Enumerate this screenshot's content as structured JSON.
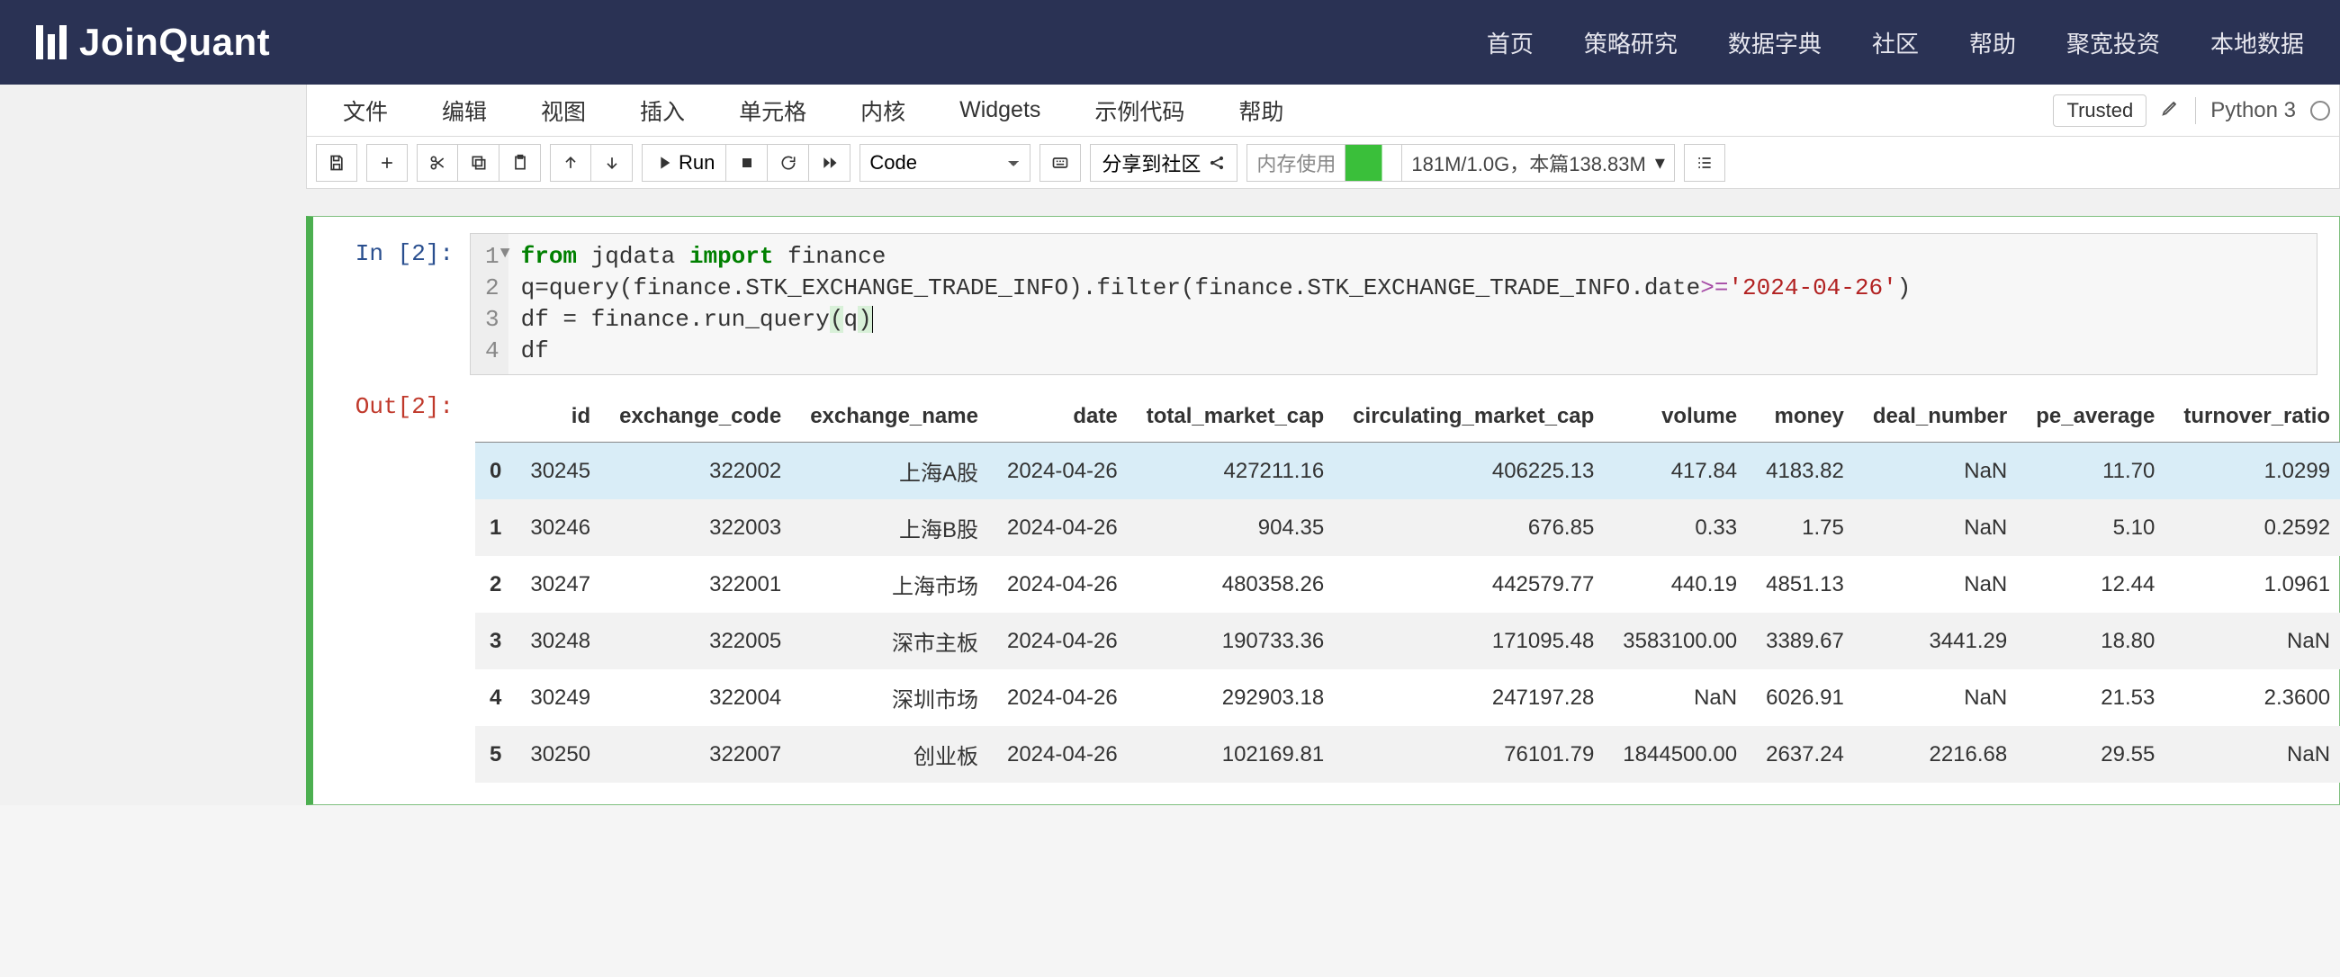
{
  "brand": "JoinQuant",
  "nav": {
    "items": [
      "首页",
      "策略研究",
      "数据字典",
      "社区",
      "帮助",
      "聚宽投资",
      "本地数据"
    ]
  },
  "menubar": {
    "items": [
      "文件",
      "编辑",
      "视图",
      "插入",
      "单元格",
      "内核",
      "Widgets",
      "示例代码",
      "帮助"
    ],
    "trusted": "Trusted",
    "kernel": "Python 3"
  },
  "toolbar": {
    "run": "Run",
    "celltype": "Code",
    "share": "分享到社区",
    "mem_label": "内存使用",
    "mem_text": "181M/1.0G，本篇138.83M"
  },
  "cell": {
    "in_prompt": "In [2]:",
    "out_prompt": "Out[2]:",
    "gutter": [
      "1",
      "2",
      "3",
      "4"
    ],
    "code": {
      "date_literal": "'2024-04-26'"
    }
  },
  "df": {
    "columns": [
      "id",
      "exchange_code",
      "exchange_name",
      "date",
      "total_market_cap",
      "circulating_market_cap",
      "volume",
      "money",
      "deal_number",
      "pe_average",
      "turnover_ratio"
    ],
    "index": [
      "0",
      "1",
      "2",
      "3",
      "4",
      "5"
    ],
    "rows": [
      [
        "30245",
        "322002",
        "上海A股",
        "2024-04-26",
        "427211.16",
        "406225.13",
        "417.84",
        "4183.82",
        "NaN",
        "11.70",
        "1.0299"
      ],
      [
        "30246",
        "322003",
        "上海B股",
        "2024-04-26",
        "904.35",
        "676.85",
        "0.33",
        "1.75",
        "NaN",
        "5.10",
        "0.2592"
      ],
      [
        "30247",
        "322001",
        "上海市场",
        "2024-04-26",
        "480358.26",
        "442579.77",
        "440.19",
        "4851.13",
        "NaN",
        "12.44",
        "1.0961"
      ],
      [
        "30248",
        "322005",
        "深市主板",
        "2024-04-26",
        "190733.36",
        "171095.48",
        "3583100.00",
        "3389.67",
        "3441.29",
        "18.80",
        "NaN"
      ],
      [
        "30249",
        "322004",
        "深圳市场",
        "2024-04-26",
        "292903.18",
        "247197.28",
        "NaN",
        "6026.91",
        "NaN",
        "21.53",
        "2.3600"
      ],
      [
        "30250",
        "322007",
        "创业板",
        "2024-04-26",
        "102169.81",
        "76101.79",
        "1844500.00",
        "2637.24",
        "2216.68",
        "29.55",
        "NaN"
      ]
    ]
  }
}
